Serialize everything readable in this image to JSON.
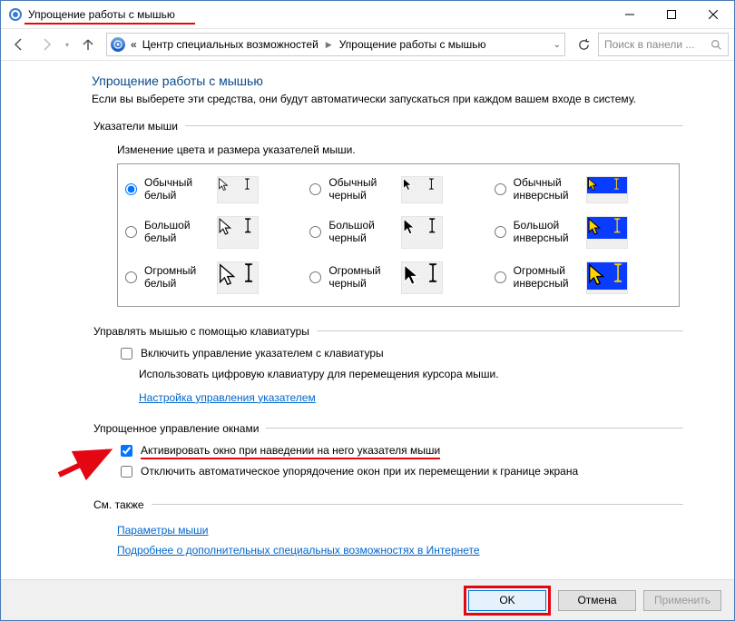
{
  "titlebar": {
    "title": "Упрощение работы с мышью"
  },
  "toolbar": {
    "crumb1": "Центр специальных возможностей",
    "crumb2": "Упрощение работы с мышью",
    "chevrons": "«",
    "search_placeholder": "Поиск в панели ..."
  },
  "page": {
    "title": "Упрощение работы с мышью",
    "desc": "Если вы выберете эти средства, они будут автоматически запускаться при каждом вашем входе в систему."
  },
  "pointers": {
    "legend": "Указатели мыши",
    "sub": "Изменение цвета и размера указателей мыши.",
    "items": [
      {
        "label": "Обычный белый",
        "scheme": "white",
        "size": "s"
      },
      {
        "label": "Обычный черный",
        "scheme": "black",
        "size": "s"
      },
      {
        "label": "Обычный инверсный",
        "scheme": "invert",
        "size": "s"
      },
      {
        "label": "Большой белый",
        "scheme": "white",
        "size": "m"
      },
      {
        "label": "Большой черный",
        "scheme": "black",
        "size": "m"
      },
      {
        "label": "Большой инверсный",
        "scheme": "invert",
        "size": "m"
      },
      {
        "label": "Огромный белый",
        "scheme": "white",
        "size": "l"
      },
      {
        "label": "Огромный черный",
        "scheme": "black",
        "size": "l"
      },
      {
        "label": "Огромный инверсный",
        "scheme": "invert",
        "size": "l"
      }
    ],
    "selected": 0
  },
  "keyboard": {
    "legend": "Управлять мышью с помощью клавиатуры",
    "cb": "Включить управление указателем с клавиатуры",
    "desc": "Использовать цифровую клавиатуру для перемещения курсора мыши.",
    "link": "Настройка управления указателем"
  },
  "windows": {
    "legend": "Упрощенное управление окнами",
    "cb1": "Активировать окно при наведении на него указателя мыши",
    "cb2": "Отключить автоматическое упорядочение окон при их перемещении к границе экрана"
  },
  "seealso": {
    "legend": "См. также",
    "link1": "Параметры мыши",
    "link2": "Подробнее о дополнительных специальных возможностях в Интернете"
  },
  "footer": {
    "ok": "OK",
    "cancel": "Отмена",
    "apply": "Применить"
  }
}
